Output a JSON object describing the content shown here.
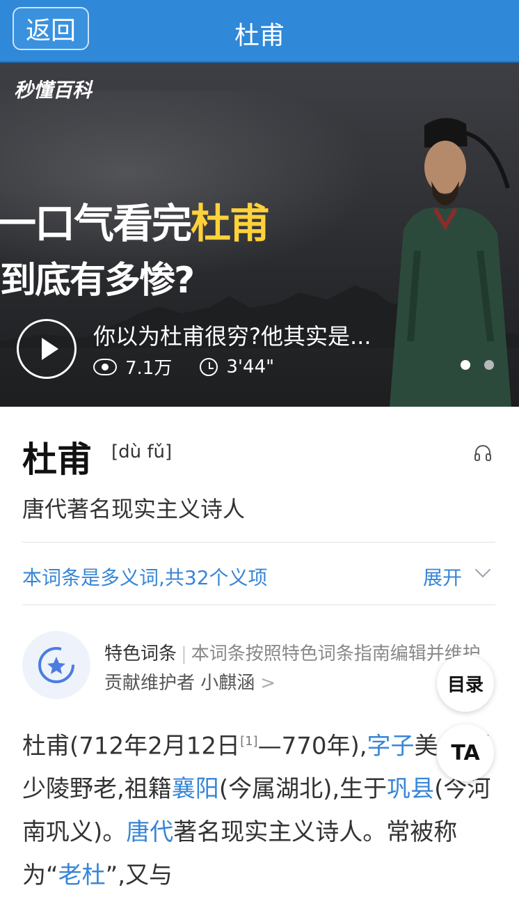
{
  "header": {
    "back_label": "返回",
    "title": "杜甫"
  },
  "video": {
    "logo": "秒懂百科",
    "headline_part1": "一口气看完",
    "headline_highlight": "杜甫",
    "headline_line2": "到底有多惨?",
    "title": "你以为杜甫很穷?他其实是...",
    "views": "7.1万",
    "duration": "3'44\"",
    "carousel_active": 0,
    "carousel_count": 2
  },
  "entry": {
    "title": "杜甫",
    "pinyin": "[dù fǔ]",
    "description": "唐代著名现实主义诗人",
    "polysemy_text": "本词条是多义词,共32个义项",
    "expand_label": "展开"
  },
  "feature": {
    "label": "特色词条",
    "note": "本词条按照特色词条指南编辑并维护",
    "contributor": "贡献维护者 小麒涵",
    "arrow": ">"
  },
  "body": {
    "p1": "杜甫(712年2月12日",
    "ref": "[1]",
    "p2": "—770年),",
    "link1": "字子",
    "p3": "美,自号少陵野老,祖籍",
    "link2": "襄阳",
    "p4": "(今属湖北),生于",
    "link3": "巩县",
    "p5": "(今河南巩义)。",
    "link4": "唐代",
    "p6": "著名现实主义诗人。常被称为“",
    "link5": "老杜",
    "p7": "”,又与"
  },
  "floating": {
    "toc_label": "目录",
    "ta_label": "TA"
  },
  "colors": {
    "header_bg": "#2f88d8",
    "link": "#3886d6",
    "headline_highlight": "#ffd23a"
  }
}
